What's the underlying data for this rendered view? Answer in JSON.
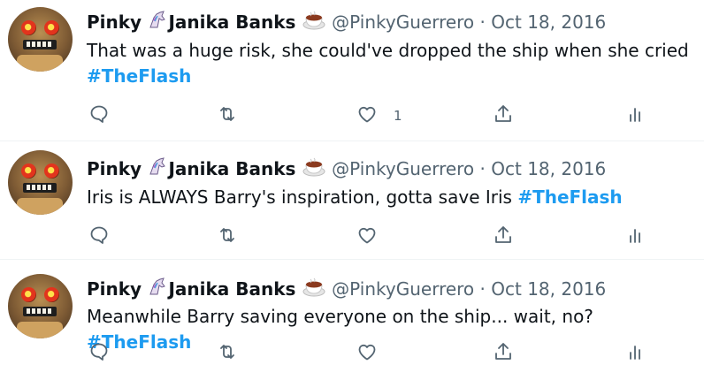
{
  "tweets": [
    {
      "display_name_first": "Pinky",
      "display_name_last": "Janika Banks",
      "handle": "@PinkyGuerrero",
      "separator": "·",
      "date": "Oct 18, 2016",
      "text": "That was a huge risk, she could've dropped the ship when she cried",
      "hashtag": "#TheFlash",
      "like_count": "1"
    },
    {
      "display_name_first": "Pinky",
      "display_name_last": "Janika Banks",
      "handle": "@PinkyGuerrero",
      "separator": "·",
      "date": "Oct 18, 2016",
      "text": "Iris is ALWAYS Barry's inspiration, gotta save Iris ",
      "hashtag": "#TheFlash",
      "like_count": ""
    },
    {
      "display_name_first": "Pinky",
      "display_name_last": "Janika Banks",
      "handle": "@PinkyGuerrero",
      "separator": "·",
      "date": "Oct 18, 2016",
      "text": "Meanwhile Barry saving everyone on the ship... wait, no? ",
      "hashtag": "#TheFlash",
      "like_count": ""
    }
  ],
  "icons": {
    "name_emoji_1": "unicorn-icon",
    "name_emoji_2": "coffee-cup-icon",
    "reply": "reply-icon",
    "retweet": "retweet-icon",
    "like": "heart-icon",
    "share": "share-icon",
    "analytics": "analytics-icon"
  },
  "colors": {
    "hashtag": "#1d9bf0",
    "meta": "#536471",
    "divider": "#eff3f4"
  }
}
